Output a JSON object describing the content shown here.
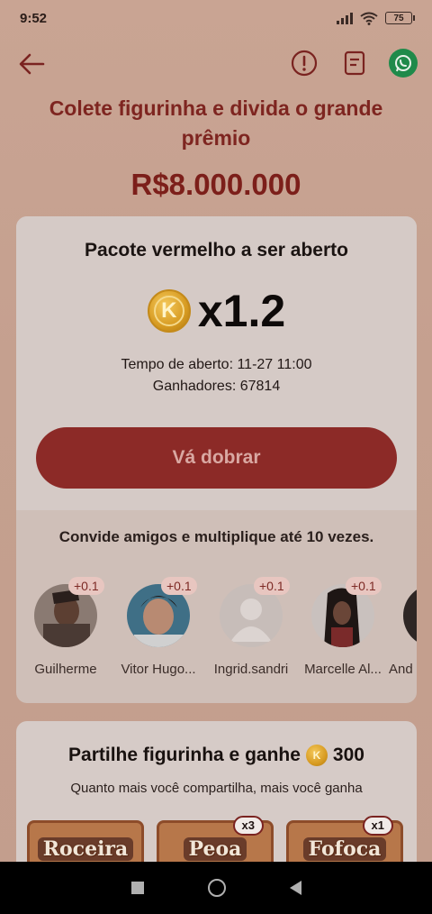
{
  "status_bar": {
    "time": "9:52",
    "battery": "75"
  },
  "header": {
    "title": "Colete figurinha e divida o grande prêmio",
    "prize": "R$8.000.000",
    "icons": [
      "back-arrow-icon",
      "alert-icon",
      "document-icon",
      "whatsapp-icon"
    ]
  },
  "packet_card": {
    "title": "Pacote vermelho a ser aberto",
    "coin_letter": "K",
    "multiplier": "x1.2",
    "open_time": "Tempo de aberto: 11-27 11:00",
    "winners": "Ganhadores: 67814",
    "button_label": "Vá dobrar"
  },
  "invite": {
    "text": "Convide amigos e multiplique até 10 vezes.",
    "friends": [
      {
        "name": "Guilherme",
        "bonus": "+0.1"
      },
      {
        "name": "Vitor Hugo...",
        "bonus": "+0.1"
      },
      {
        "name": "Ingrid.sandri",
        "bonus": "+0.1"
      },
      {
        "name": "Marcelle Al...",
        "bonus": "+0.1"
      },
      {
        "name": "And",
        "bonus": ""
      }
    ]
  },
  "share_card": {
    "title": "Partilhe figurinha e ganhe",
    "reward": "300",
    "subtitle": "Quanto mais você compartilha, mais você ganha",
    "stickers": [
      {
        "label": "Roceira",
        "count": ""
      },
      {
        "label": "Peoa",
        "count": "x3"
      },
      {
        "label": "Fofoca",
        "count": "x1"
      }
    ]
  },
  "colors": {
    "accent": "#8c2a27",
    "title_red": "#7e2520",
    "whatsapp": "#1f8a4a",
    "coin": "#d79b22"
  }
}
